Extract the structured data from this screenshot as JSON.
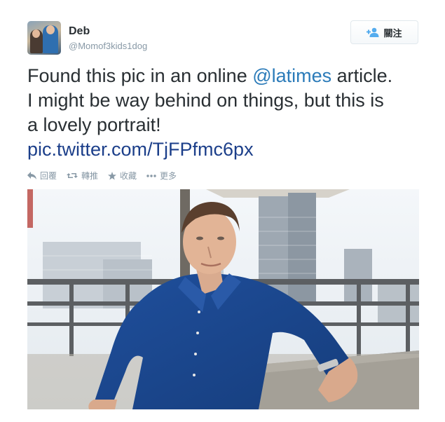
{
  "user": {
    "name": "Deb",
    "handle": "@Momof3kids1dog"
  },
  "follow": {
    "label": "關注"
  },
  "tweet": {
    "line1_before": "Found this pic in an online ",
    "mention": "@latimes",
    "line1_after": " article.",
    "line2": "I might be way behind on things, but this is",
    "line3": "a lovely portrait!",
    "link": "pic.twitter.com/TjFPfmc6px"
  },
  "actions": {
    "reply": "回覆",
    "retweet": "轉推",
    "favorite": "收藏",
    "more": "更多"
  },
  "icons": {
    "follow": "add-user-icon",
    "reply": "reply-arrow-icon",
    "retweet": "retweet-icon",
    "favorite": "star-icon",
    "more": "ellipsis-icon"
  },
  "colors": {
    "link": "#2b7bb9",
    "muted": "#8899a6",
    "text": "#292f33"
  }
}
